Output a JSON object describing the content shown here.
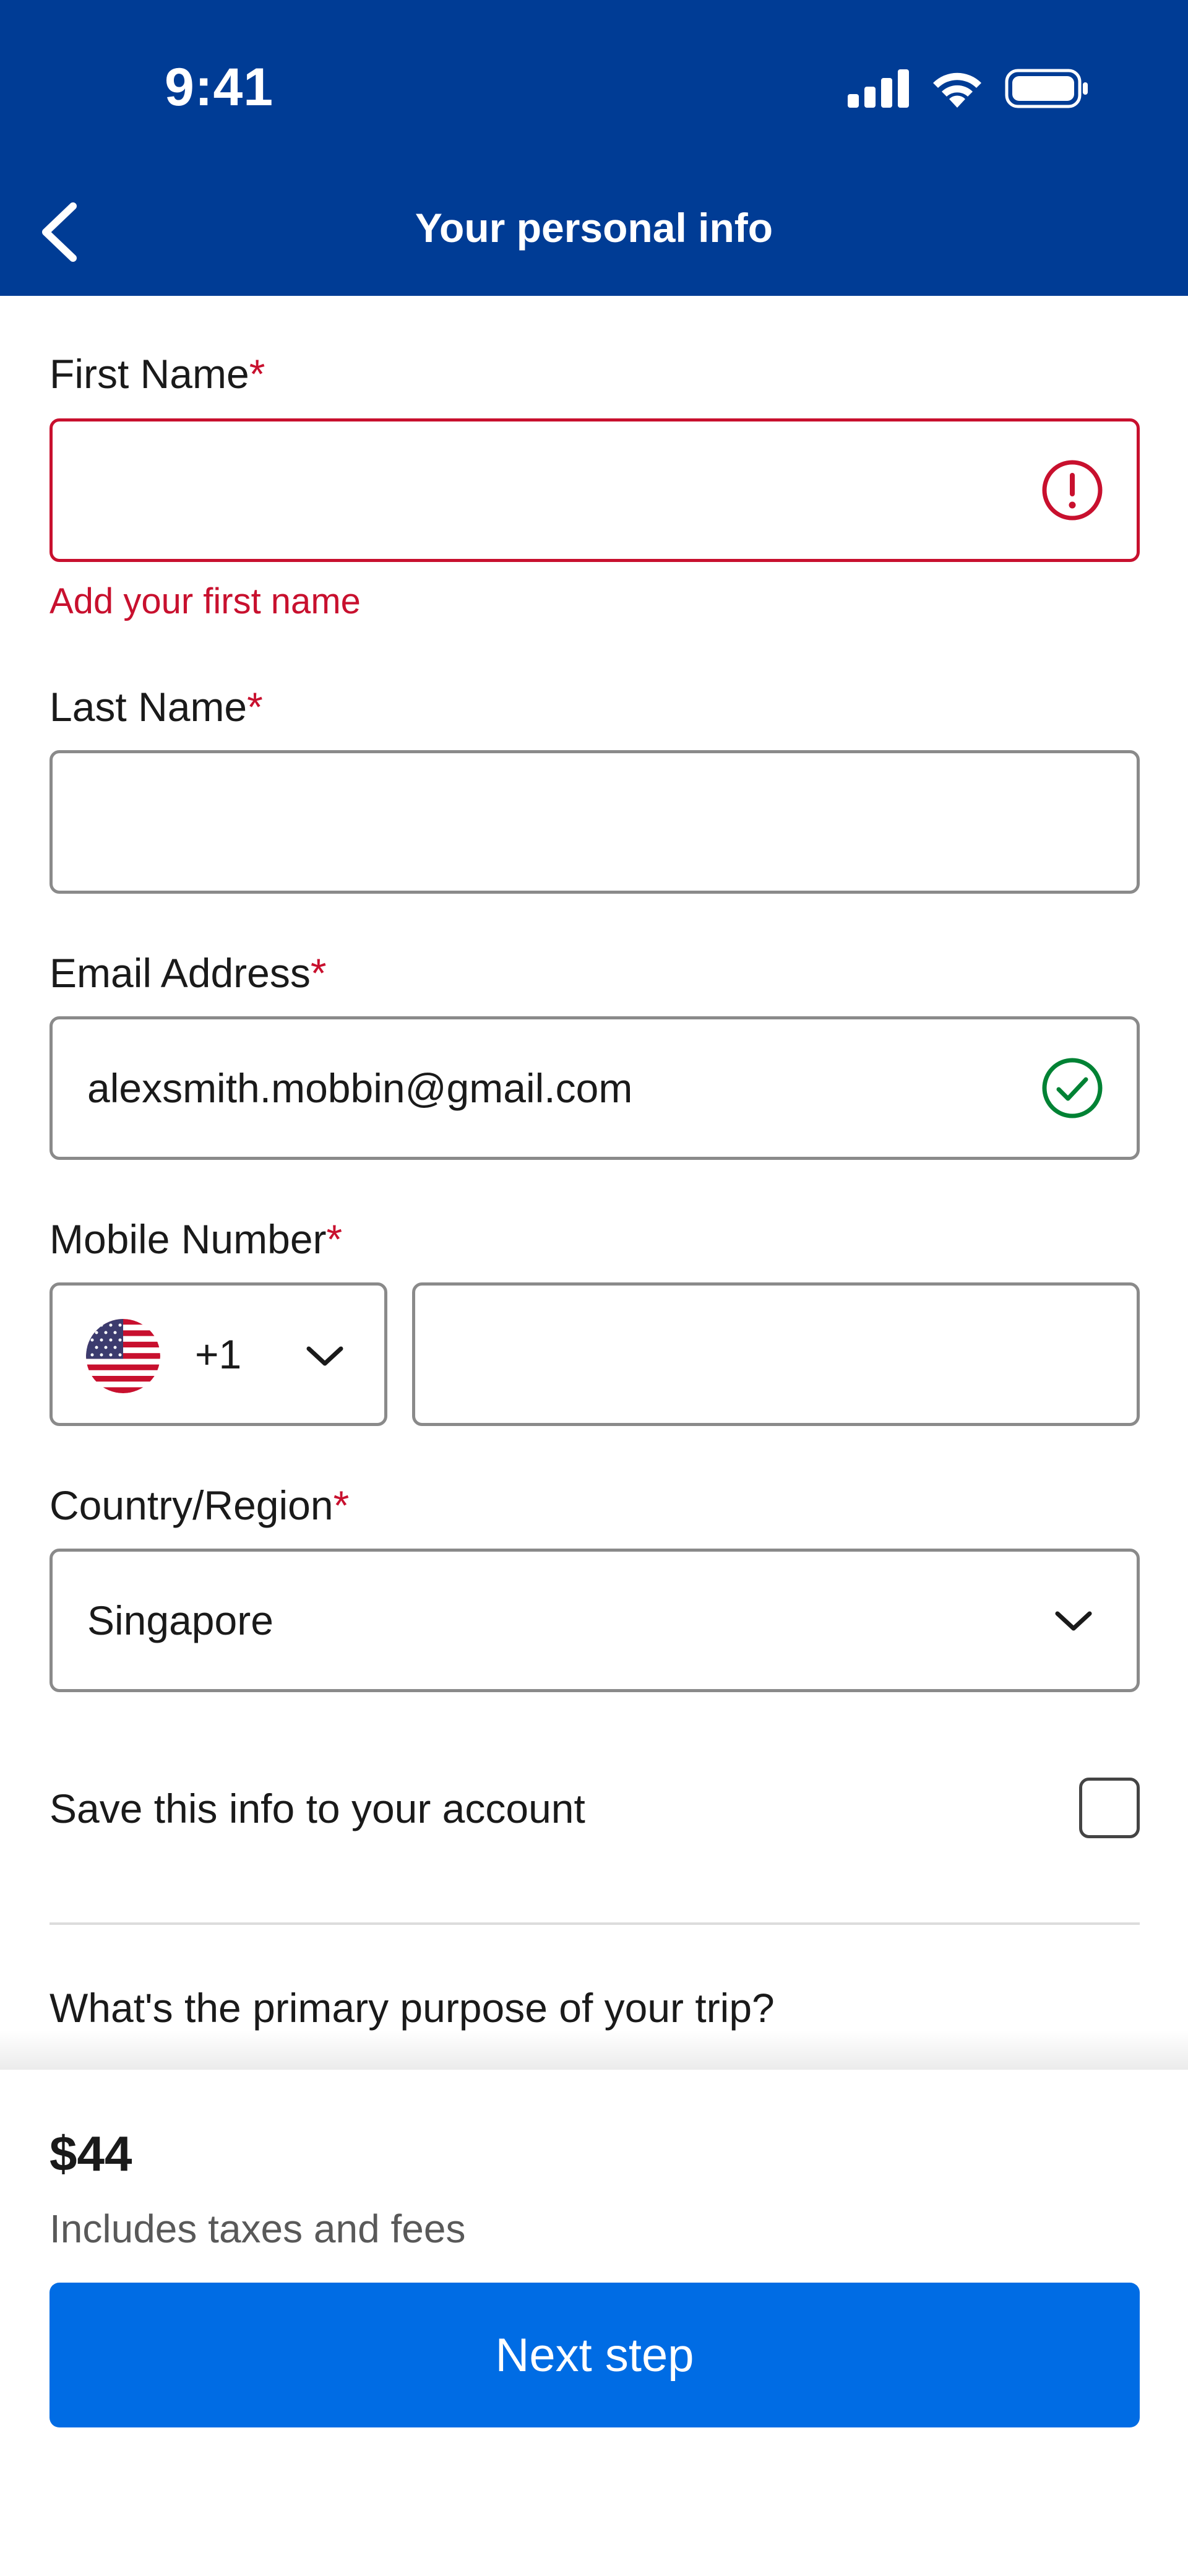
{
  "status_bar": {
    "time": "9:41"
  },
  "header": {
    "title": "Your personal info"
  },
  "form": {
    "first_name": {
      "label": "First Name",
      "required_mark": "*",
      "value": "",
      "error": "Add your first name"
    },
    "last_name": {
      "label": "Last Name",
      "required_mark": "*",
      "value": ""
    },
    "email": {
      "label": "Email Address",
      "required_mark": "*",
      "value": "alexsmith.mobbin@gmail.com"
    },
    "mobile": {
      "label": "Mobile Number",
      "required_mark": "*",
      "country_code": "+1",
      "value": ""
    },
    "country": {
      "label": "Country/Region",
      "required_mark": "*",
      "value": "Singapore"
    },
    "save_info": {
      "label": "Save this info to your account",
      "checked": false
    },
    "purpose_question": "What's the primary purpose of your trip?"
  },
  "footer": {
    "price": "$44",
    "price_note": "Includes taxes and fees",
    "next_button": "Next step"
  },
  "colors": {
    "header_bg": "#003c95",
    "error": "#c8102e",
    "success": "#008234",
    "primary_button": "#006ce4"
  },
  "icons": [
    "back-arrow-icon",
    "signal-icon",
    "wifi-icon",
    "battery-icon",
    "error-icon",
    "check-circle-icon",
    "us-flag-icon",
    "chevron-down-icon"
  ]
}
